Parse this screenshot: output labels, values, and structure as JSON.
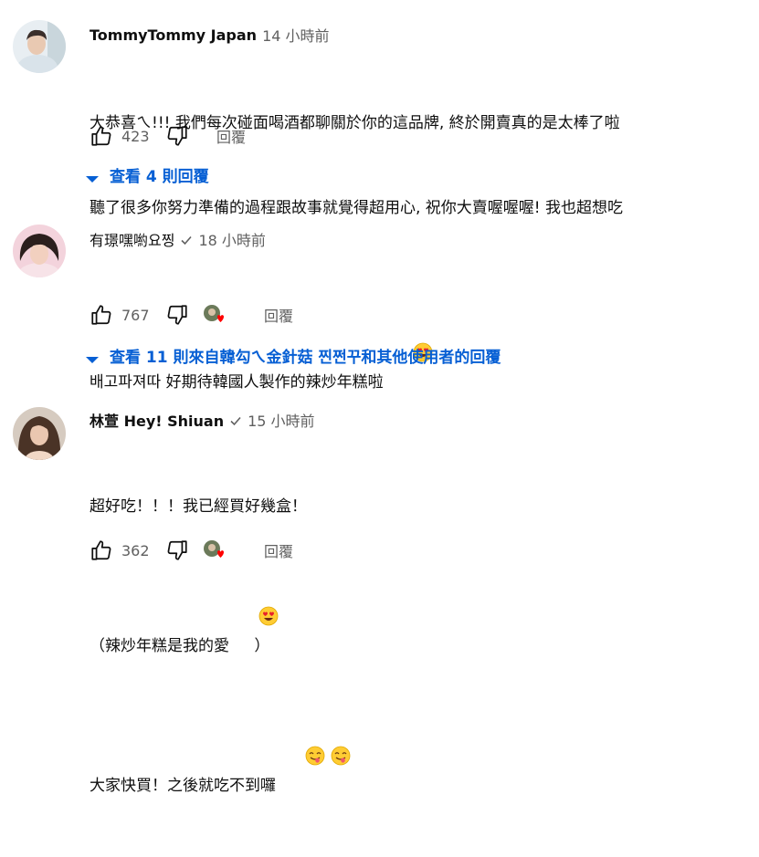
{
  "comments": [
    {
      "author": "TommyTommy Japan",
      "verified": false,
      "time": "14 小時前",
      "lines": [
        "大恭喜ㄟ!!! 我們每次碰面喝酒都聊關於你的這品牌, 終於開賣真的是太棒了啦",
        "聽了很多你努力準備的過程跟故事就覺得超用心, 祝你大賣喔喔喔! 我也超想吃"
      ],
      "likes": "423",
      "reply_label": "回覆",
      "creator_heart": false,
      "view_replies": "查看 4 則回覆"
    },
    {
      "author": "有璟嘿喲요찡",
      "verified": true,
      "time": "18 小時前",
      "lines": [
        "배고파져따 好期待韓國人製作的辣炒年糕啦"
      ],
      "likes": "767",
      "reply_label": "回覆",
      "creator_heart": true,
      "view_replies": "查看 11 則來自韓勾ㄟ金針菇 찐쩐꾸和其他使用者的回覆"
    },
    {
      "author": "林萱 Hey! Shiuan",
      "verified": true,
      "time": "15 小時前",
      "lines": [
        "超好吃！！！我已經買好幾盒！",
        "（辣炒年糕是我的愛",
        "大家快買！之後就吃不到囉"
      ],
      "line_tail": [
        "",
        " ）",
        ""
      ],
      "likes": "362",
      "reply_label": "回覆",
      "creator_heart": true
    }
  ],
  "colors": {
    "link": "#065fd4",
    "meta": "#606060",
    "text": "#0f0f0f",
    "heart": "#ff0000"
  },
  "icons": [
    "like-icon",
    "dislike-icon",
    "verified-check-icon",
    "creator-heart-icon",
    "caret-down-icon",
    "heart-eyes-emoji",
    "savoring-food-emoji"
  ]
}
